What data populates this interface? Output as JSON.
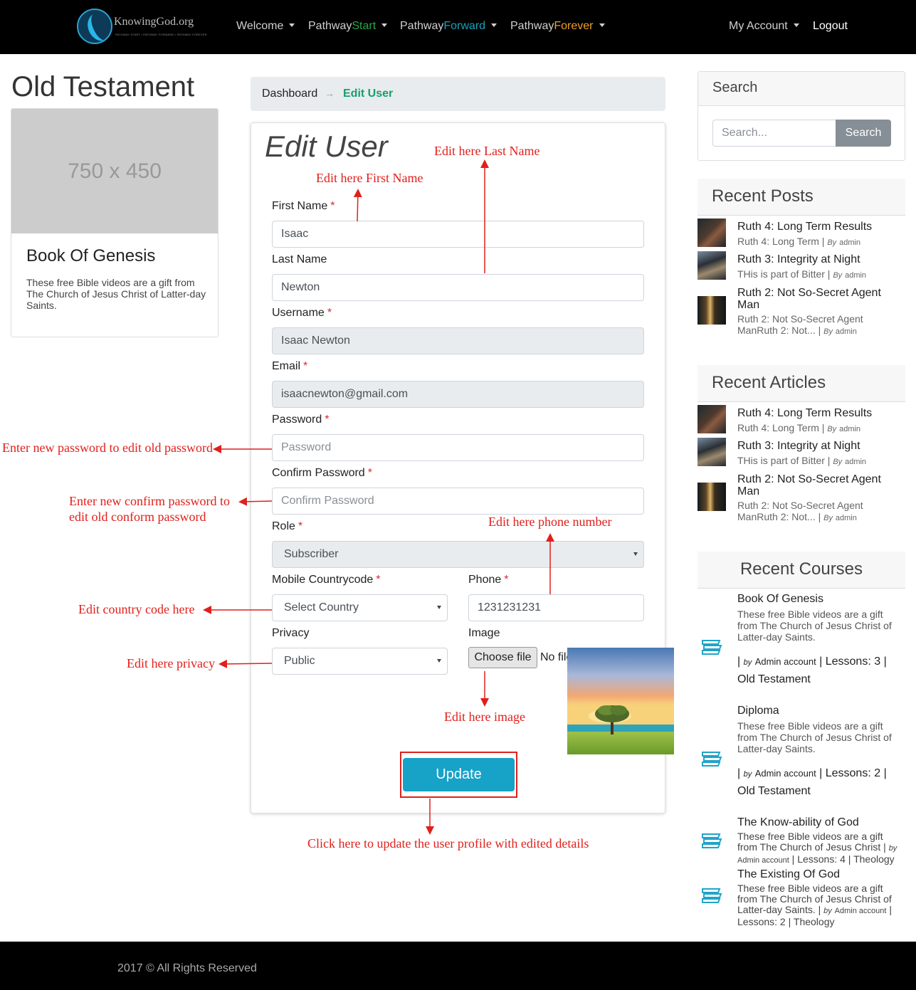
{
  "nav": {
    "logo_text": "KnowingGod.org",
    "logo_sub": "PATHWAY START • PATHWAY FORWARD • PATHWAY FOREVER",
    "welcome": "Welcome",
    "pathway_start": {
      "prefix": "Pathway",
      "suffix": "Start"
    },
    "pathway_forward": {
      "prefix": "Pathway",
      "suffix": "Forward"
    },
    "pathway_forever": {
      "prefix": "Pathway",
      "suffix": "Forever"
    },
    "my_account": "My Account",
    "logout": "Logout"
  },
  "left": {
    "heading": "Old Testament",
    "card": {
      "placeholder": "750 x 450",
      "title": "Book Of Genesis",
      "text": "These free Bible videos are a gift from The Church of Jesus Christ of Latter-day Saints."
    }
  },
  "breadcrumb": {
    "home": "Dashboard",
    "separator": "→",
    "active": "Edit User"
  },
  "form": {
    "title": "Edit User",
    "first_name": {
      "label": "First Name",
      "value": "Isaac"
    },
    "last_name": {
      "label": "Last Name",
      "value": "Newton"
    },
    "username": {
      "label": "Username",
      "value": "Isaac Newton"
    },
    "email": {
      "label": "Email",
      "value": "isaacnewton@gmail.com"
    },
    "password": {
      "label": "Password",
      "placeholder": "Password"
    },
    "confirm_password": {
      "label": "Confirm Password",
      "placeholder": "Confirm Password"
    },
    "role": {
      "label": "Role",
      "value": "Subscriber"
    },
    "country_code": {
      "label": "Mobile Countrycode",
      "value": "Select Country"
    },
    "phone": {
      "label": "Phone",
      "value": "1231231231"
    },
    "privacy": {
      "label": "Privacy",
      "value": "Public"
    },
    "image": {
      "label": "Image",
      "button": "Choose file",
      "status": "No file chosen"
    },
    "required_mark": "*",
    "update": "Update"
  },
  "annotations": {
    "first_name": "Edit here First Name",
    "last_name": "Edit here Last Name",
    "password": "Enter new password to edit old password",
    "confirm_line1": "Enter new confirm password to",
    "confirm_line2": "edit old conform password",
    "phone": "Edit here phone number",
    "country": "Edit country code here",
    "privacy": "Edit here privacy",
    "image": "Edit here image",
    "update": "Click here to update the user profile with edited details"
  },
  "sidebar": {
    "search": {
      "title": "Search",
      "placeholder": "Search...",
      "button": "Search"
    },
    "recent_posts": {
      "title": "Recent Posts",
      "items": [
        {
          "title": "Ruth 4: Long Term Results",
          "excerpt": "Ruth 4: Long Term",
          "by": "By",
          "author": "admin"
        },
        {
          "title": "Ruth 3: Integrity at Night",
          "excerpt": "THis is part of Bitter",
          "by": "By",
          "author": "admin"
        },
        {
          "title": "Ruth 2: Not So-Secret Agent Man",
          "excerpt": "Ruth 2: Not So-Secret Agent ManRuth 2: Not...",
          "by": "By",
          "author": "admin"
        }
      ]
    },
    "recent_articles": {
      "title": "Recent Articles",
      "items": [
        {
          "title": "Ruth 4: Long Term Results",
          "excerpt": "Ruth 4: Long Term",
          "by": "By",
          "author": "admin"
        },
        {
          "title": "Ruth 3: Integrity at Night",
          "excerpt": "THis is part of Bitter",
          "by": "By",
          "author": "admin"
        },
        {
          "title": "Ruth 2: Not So-Secret Agent Man",
          "excerpt": "Ruth 2: Not So-Secret Agent ManRuth 2: Not...",
          "by": "By",
          "author": "admin"
        }
      ]
    },
    "recent_courses": {
      "title": "Recent Courses",
      "items": [
        {
          "title": "Book Of Genesis",
          "desc": "These free Bible videos are a gift from The Church of Jesus Christ of Latter-day Saints.",
          "by": "by",
          "author": "Admin account",
          "lessons": "Lessons: 3",
          "category": "Old Testament"
        },
        {
          "title": "Diploma",
          "desc": "These free Bible videos are a gift from The Church of Jesus Christ of Latter-day Saints.",
          "by": "by",
          "author": "Admin account",
          "lessons": "Lessons: 2",
          "category": "Old Testament"
        },
        {
          "title": "The Know-ability of God",
          "desc": "These free Bible videos are a gift from The Church of Jesus Christ",
          "by": "by",
          "author": "Admin account",
          "lessons": "Lessons: 4",
          "category": "Theology"
        },
        {
          "title": "The Existing Of God",
          "desc": "These free Bible videos are a gift from The Church of Jesus Christ of Latter-day Saints.",
          "by": "by",
          "author": "Admin account",
          "lessons": "Lessons: 2",
          "category": "Theology"
        }
      ]
    }
  },
  "footer": {
    "text": "2017 © All Rights Reserved"
  },
  "colors": {
    "accent": "#17a2b8",
    "annotation": "#e0201c",
    "start": "#28a745",
    "forward": "#17a2b8",
    "forever": "#f0a020",
    "breadcrumb_active": "#17a06a"
  }
}
